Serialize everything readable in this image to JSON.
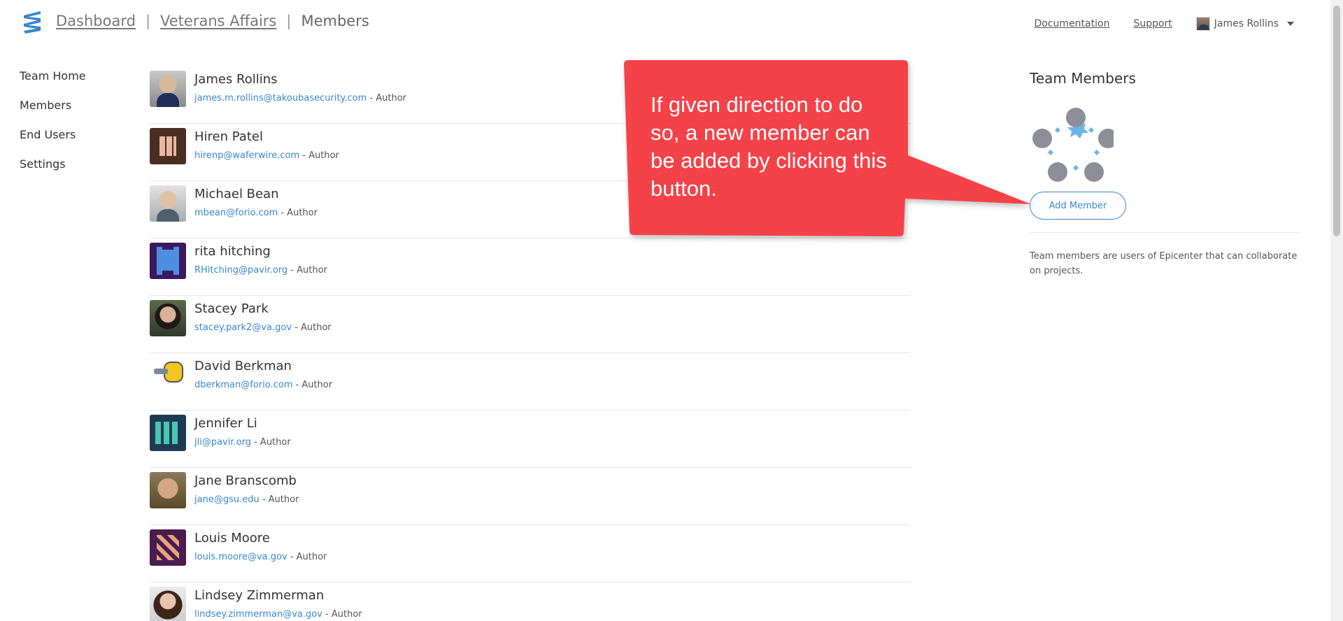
{
  "header": {
    "breadcrumb": [
      "Dashboard",
      "Veterans Affairs",
      "Members"
    ],
    "links": {
      "documentation": "Documentation",
      "support": "Support"
    },
    "user_name": "James Rollins"
  },
  "sidebar": {
    "items": [
      {
        "label": "Team Home"
      },
      {
        "label": "Members"
      },
      {
        "label": "End Users"
      },
      {
        "label": "Settings"
      }
    ]
  },
  "members": [
    {
      "name": "James Rollins",
      "email": "james.m.rollins@takoubasecurity.com",
      "role": " - Author",
      "avatar": "photo"
    },
    {
      "name": "Hiren Patel",
      "email": "hirenp@waferwire.com",
      "role": " - Author",
      "avatar": "pixel-brown"
    },
    {
      "name": "Michael Bean",
      "email": "mbean@forio.com",
      "role": " - Author",
      "avatar": "photo"
    },
    {
      "name": "rita hitching",
      "email": "RHitching@pavir.org",
      "role": " - Author",
      "avatar": "pixel-purple"
    },
    {
      "name": "Stacey Park",
      "email": "stacey.park2@va.gov",
      "role": " - Author",
      "avatar": "photo"
    },
    {
      "name": "David Berkman",
      "email": "dberkman@forio.com",
      "role": " - Author",
      "avatar": "robot"
    },
    {
      "name": "Jennifer Li",
      "email": "jli@pavir.org",
      "role": " - Author",
      "avatar": "pixel-teal"
    },
    {
      "name": "Jane Branscomb",
      "email": "jane@gsu.edu",
      "role": " - Author",
      "avatar": "photo"
    },
    {
      "name": "Louis Moore",
      "email": "louis.moore@va.gov",
      "role": " - Author",
      "avatar": "pixel-plum"
    },
    {
      "name": "Lindsey Zimmerman",
      "email": "lindsey.zimmerman@va.gov",
      "role": " - Author",
      "avatar": "photo"
    }
  ],
  "panel": {
    "title": "Team Members",
    "add_member_label": "Add Member",
    "description": "Team members are users of Epicenter that can collaborate on projects."
  },
  "callout": {
    "text": "If given direction to do so, a new member can be added by clicking this button."
  },
  "colors": {
    "accent": "#3a86cf",
    "callout": "#f5424a",
    "team_graphic_circle": "#8e8e98",
    "team_graphic_star": "#6ab6e6"
  },
  "icons": {
    "logo": "epicenter-logo",
    "user_menu": "chevron-down-icon"
  }
}
